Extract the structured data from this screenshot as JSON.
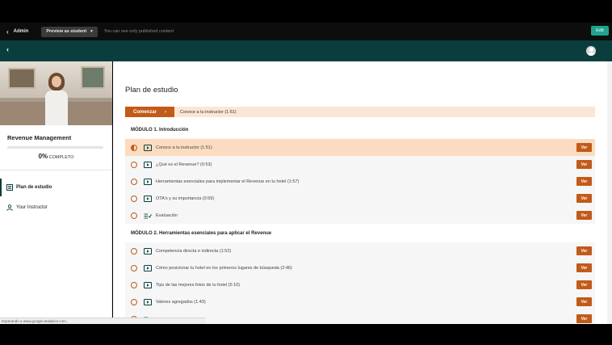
{
  "admin_bar": {
    "back_label": "Admin",
    "preview_label": "Preview as student",
    "preview_note": "You can see only published content",
    "edit_label": "Edit"
  },
  "sidebar": {
    "course_title": "Revenue Management",
    "progress_percent": "0%",
    "progress_fraction": 0,
    "progress_label": "COMPLETO",
    "nav": [
      {
        "label": "Plan de estudio",
        "icon": "curriculum-icon"
      },
      {
        "label": "Your Instructor",
        "icon": "person-icon"
      }
    ]
  },
  "main": {
    "title": "Plan de estudio",
    "start_button": "Comenzar",
    "start_lesson": "Conoce a tu instructor (1:51)",
    "modules": [
      {
        "title": "MÓDULO 1. Introducción",
        "lessons": [
          {
            "title": "Conoce a tu instructor (1:51)",
            "type": "video",
            "button": "Ver"
          },
          {
            "title": "¿Qué es el Revenue? (0:53)",
            "type": "video",
            "button": "Ver"
          },
          {
            "title": "Herramientas esenciales para implementar el Revenue en tu hotel (1:57)",
            "type": "video",
            "button": "Ver"
          },
          {
            "title": "OTA's y su importancia (0:59)",
            "type": "video",
            "button": "Ver"
          },
          {
            "title": "Evaluación",
            "type": "quiz",
            "button": "Ver"
          }
        ]
      },
      {
        "title": "MÓDULO 2. Herramientas esenciales para aplicar el Revenue",
        "lessons": [
          {
            "title": "Competencia directa e indirecta (1:52)",
            "type": "video",
            "button": "Ver"
          },
          {
            "title": "Cómo posicionar tu hotel en los primeros lugares de búsqueda (2:46)",
            "type": "video",
            "button": "Ver"
          },
          {
            "title": "Tips de las mejores fotos de tu hotel (5:10)",
            "type": "video",
            "button": "Ver"
          },
          {
            "title": "Valores agregados (1:43)",
            "type": "video",
            "button": "Ver"
          },
          {
            "title": "",
            "type": "quiz",
            "button": "Ver"
          }
        ]
      }
    ]
  },
  "status_bar": {
    "text": "Esperando a www.google-analytics.com..."
  },
  "colors": {
    "accent": "#c25a1a",
    "header": "#0a3e3e",
    "edit": "#1fa38d"
  }
}
